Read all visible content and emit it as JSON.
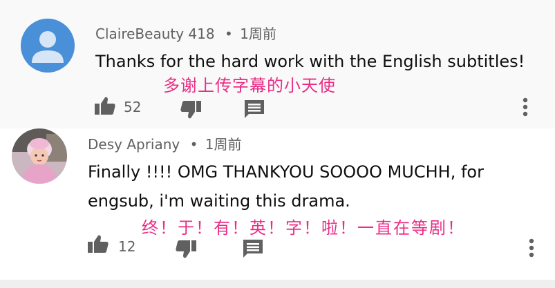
{
  "comments": [
    {
      "author": "ClaireBeauty 418",
      "separator": "•",
      "time": "1周前",
      "text_lines": [
        "Thanks for the hard work with the English subtitles!"
      ],
      "annotation": "多谢上传字幕的小天使",
      "likes": "52",
      "avatar_color": "#4a90d9"
    },
    {
      "author": "Desy Apriany",
      "separator": "•",
      "time": "1周前",
      "text_lines": [
        "Finally !!!! OMG THANKYOU SOOOO MUCHH, for",
        "engsub, i'm waiting this drama."
      ],
      "annotation": "终！于！有！英！字！啦！一直在等剧！",
      "likes": "12"
    }
  ],
  "colors": {
    "annotation": "#ea2d86",
    "meta_text": "#606060",
    "icon": "#606060",
    "first_comment_bg": "#f9f9f9"
  },
  "icons": [
    "thumbs-up-icon",
    "thumbs-down-icon",
    "reply-icon",
    "more-vert-icon"
  ]
}
